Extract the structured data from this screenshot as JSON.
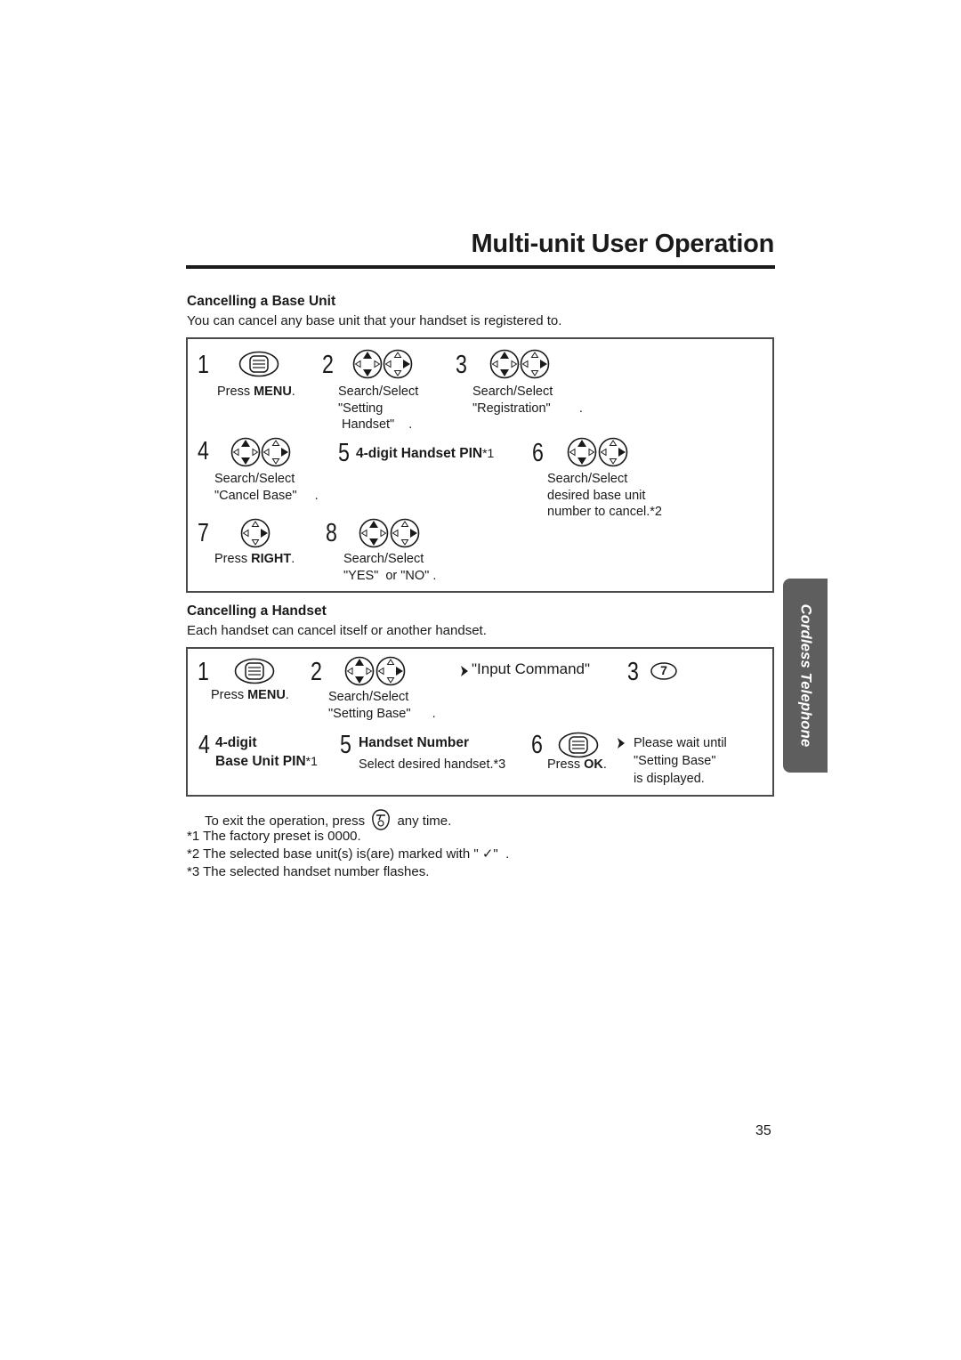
{
  "page": {
    "title": "Multi-unit User Operation",
    "page_number": "35",
    "side_tab": "Cordless Telephone"
  },
  "section_base": {
    "heading": "Cancelling a Base Unit",
    "intro": "You can cancel any base unit that your handset is registered to.",
    "steps": [
      {
        "num": "1",
        "icon": "menu-button-icon",
        "text_pre": "Press ",
        "text_bold": "MENU",
        "text_post": "."
      },
      {
        "num": "2",
        "icon": "navigator-up-down-icon, navigator-right-icon",
        "lines": [
          "Search/Select",
          "\"Setting",
          " Handset\"    ."
        ]
      },
      {
        "num": "3",
        "icon": "navigator-up-down-icon, navigator-right-icon",
        "lines": [
          "Search/Select",
          "\"Registration\"        ."
        ]
      },
      {
        "num": "4",
        "icon": "navigator-up-down-icon, navigator-right-icon",
        "lines": [
          "Search/Select",
          "\"Cancel Base\"     ."
        ]
      },
      {
        "num": "5",
        "label_bold": "4-digit Handset PIN",
        "label_sup": "*1"
      },
      {
        "num": "6",
        "icon": "navigator-up-down-icon, navigator-right-icon",
        "lines": [
          "Search/Select",
          "desired base unit",
          "number to cancel.*2"
        ]
      },
      {
        "num": "7",
        "icon": "navigator-right-icon",
        "text_pre": "Press ",
        "text_bold": "RIGHT",
        "text_post": "."
      },
      {
        "num": "8",
        "icon": "navigator-up-down-icon, navigator-right-icon",
        "lines": [
          "Search/Select",
          "\"YES\"  or \"NO\" ."
        ]
      }
    ]
  },
  "section_handset": {
    "heading": "Cancelling a Handset",
    "intro": "Each handset can cancel itself or another handset.",
    "steps": [
      {
        "num": "1",
        "icon": "menu-button-icon",
        "text_pre": "Press ",
        "text_bold": "MENU",
        "text_post": "."
      },
      {
        "num": "2",
        "icon": "navigator-up-down-icon, navigator-right-icon",
        "lines": [
          "Search/Select",
          "\"Setting Base\"      ."
        ]
      },
      {
        "result": "\"Input Command\""
      },
      {
        "num": "3",
        "key": "7"
      },
      {
        "num": "4",
        "label_bold_1": "4-digit",
        "label_bold_2": "Base Unit PIN",
        "label_sup": "*1"
      },
      {
        "num": "5",
        "label_bold": "Handset Number",
        "sub": "Select desired handset.*3"
      },
      {
        "num": "6",
        "icon": "ok-button-icon",
        "text_pre": "Press ",
        "text_bold": "OK",
        "text_post": "."
      },
      {
        "result_lines": [
          "Please wait until",
          "\"Setting Base\"",
          "is displayed."
        ]
      }
    ]
  },
  "footnotes": {
    "exit_pre": "To exit the operation, press",
    "exit_post": "any time.",
    "notes": [
      "*1 The factory preset is 0000.",
      "*2 The selected base unit(s) is(are) marked with \" ✓\"  .",
      "*3 The selected handset number flashes."
    ]
  }
}
